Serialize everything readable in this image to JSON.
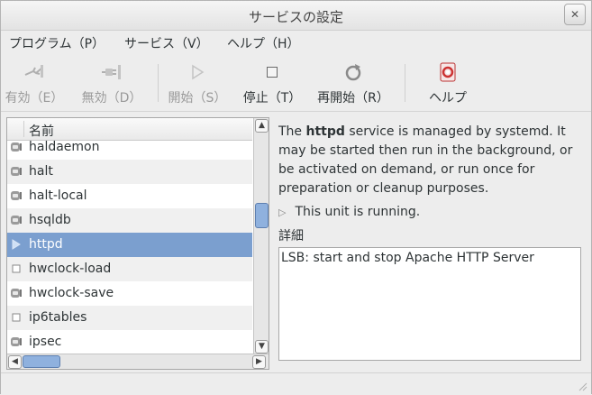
{
  "window": {
    "title": "サービスの設定"
  },
  "menubar": {
    "items": [
      "プログラム（P）",
      "サービス（V）",
      "ヘルプ（H）"
    ]
  },
  "toolbar": {
    "enable": "有効（E）",
    "disable": "無効（D）",
    "start": "開始（S）",
    "stop": "停止（T）",
    "restart": "再開始（R）",
    "help": "ヘルプ"
  },
  "list": {
    "header": "名前",
    "rows": [
      {
        "name": "haldaemon",
        "icon": "plug-icon"
      },
      {
        "name": "halt",
        "icon": "plug-icon"
      },
      {
        "name": "halt-local",
        "icon": "plug-icon"
      },
      {
        "name": "hsqldb",
        "icon": "plug-icon"
      },
      {
        "name": "httpd",
        "icon": "play-icon",
        "selected": true
      },
      {
        "name": "hwclock-load",
        "icon": "stopped-icon"
      },
      {
        "name": "hwclock-save",
        "icon": "plug-icon"
      },
      {
        "name": "ip6tables",
        "icon": "stopped-icon"
      },
      {
        "name": "ipsec",
        "icon": "plug-icon"
      }
    ]
  },
  "details": {
    "desc_pre": "The ",
    "service_name": "httpd",
    "desc_post": " service is managed by systemd. It may be started then run in the background, or be activated on demand, or run once for preparation or cleanup purposes.",
    "status": "This unit is running.",
    "label": "詳細",
    "text": "LSB: start and stop Apache HTTP Server"
  },
  "colors": {
    "selection": "#7b9fcf",
    "accent": "#8fb1de"
  }
}
